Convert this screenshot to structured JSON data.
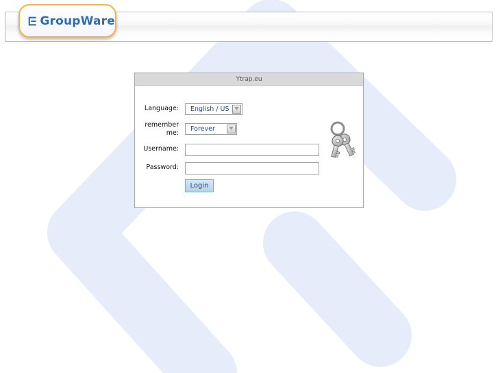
{
  "app": {
    "logo_text": "GroupWare"
  },
  "login": {
    "title": "Ytrap.eu",
    "language_label": "Language:",
    "language_value": "English / US",
    "remember_label_line1": "remember",
    "remember_label_line2": "me:",
    "remember_value": "Forever",
    "username_label": "Username:",
    "username_value": "",
    "password_label": "Password:",
    "password_value": "",
    "login_button": "Login"
  },
  "icons": {
    "logo": "egroupware-logo-icon",
    "keys": "keys-icon",
    "dropdown": "dropdown-arrow-icon"
  },
  "colors": {
    "accent": "#2e6cb4",
    "logo_border": "#f2b34a",
    "background_shape": "#e7ecfb"
  }
}
